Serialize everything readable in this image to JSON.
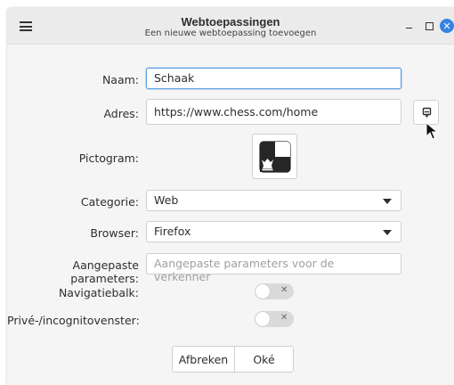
{
  "window": {
    "title": "Webtoepassingen",
    "subtitle": "Een nieuwe webtoepassing toevoegen",
    "close_glyph": "✕"
  },
  "form": {
    "name_label": "Naam:",
    "name_value": "Schaak",
    "address_label": "Adres:",
    "address_value": "https://www.chess.com/home",
    "icon_label": "Pictogram:",
    "category_label": "Categorie:",
    "category_value": "Web",
    "browser_label": "Browser:",
    "browser_value": "Firefox",
    "params_label": "Aangepaste parameters:",
    "params_value": "",
    "params_placeholder": "Aangepaste parameters voor de verkenner",
    "navbar_label": "Navigatiebalk:",
    "navbar_on": false,
    "private_label": "Privé-/incognitovenster:",
    "private_on": false,
    "switch_off_glyph": "✕"
  },
  "buttons": {
    "cancel": "Afbreken",
    "ok": "Oké"
  },
  "icons": {
    "menu": "hamburger-menu-icon",
    "favicon": "favicon-fetch-icon",
    "app": "chess-queen-icon",
    "cursor": "mouse-pointer-icon"
  }
}
